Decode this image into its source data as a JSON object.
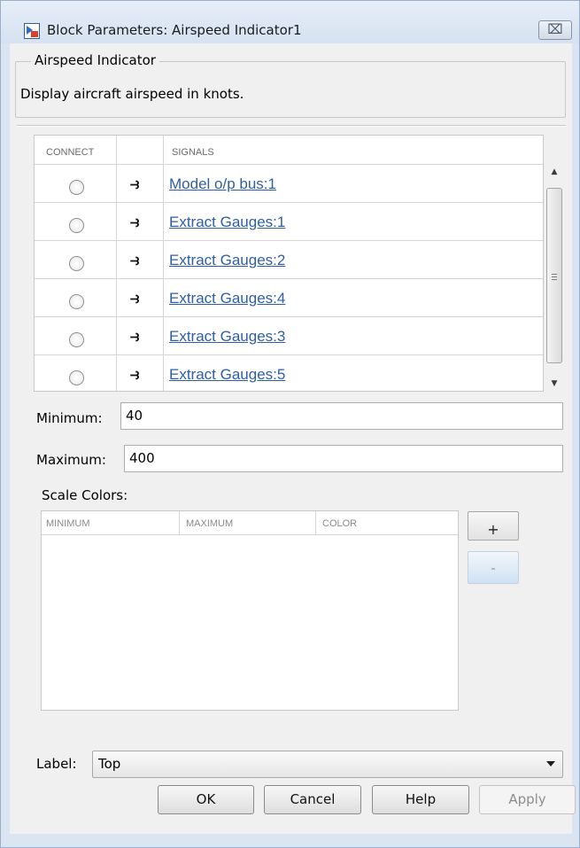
{
  "window": {
    "title": "Block Parameters: Airspeed Indicator1",
    "close_glyph": "⌧"
  },
  "description": {
    "group_title": "Airspeed Indicator",
    "text": "Display aircraft airspeed in knots."
  },
  "signals_table": {
    "headers": {
      "connect": "CONNECT",
      "signals": "SIGNALS"
    },
    "rows": [
      {
        "signal": "Model o/p bus:1"
      },
      {
        "signal": "Extract Gauges:1"
      },
      {
        "signal": "Extract Gauges:2"
      },
      {
        "signal": "Extract Gauges:4"
      },
      {
        "signal": "Extract Gauges:3"
      },
      {
        "signal": "Extract Gauges:5"
      }
    ],
    "port_icon": "port-connector-icon"
  },
  "minimum": {
    "label": "Minimum:",
    "value": "40"
  },
  "maximum": {
    "label": "Maximum:",
    "value": "400"
  },
  "scale_colors": {
    "label": "Scale Colors:",
    "headers": {
      "minimum": "MINIMUM",
      "maximum": "MAXIMUM",
      "color": "COLOR"
    },
    "add_label": "+",
    "remove_label": "-"
  },
  "label_select": {
    "label": "Label:",
    "value": "Top"
  },
  "buttons": {
    "ok": "OK",
    "cancel": "Cancel",
    "help": "Help",
    "apply": "Apply"
  }
}
